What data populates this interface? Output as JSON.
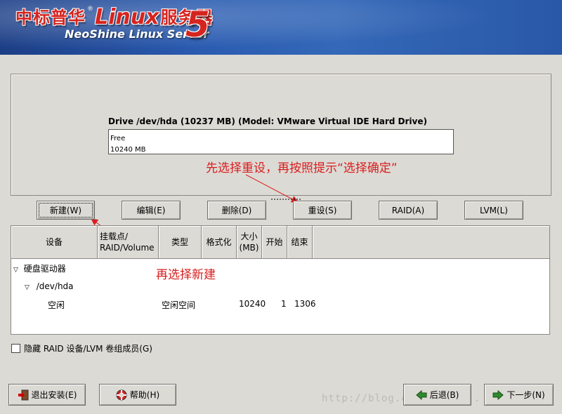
{
  "banner": {
    "logo_cn": "中标普华",
    "logo_reg": "®",
    "logo_linux": "Linux",
    "logo_cn2": "服务器",
    "logo_sub": "NeoShine Linux Server",
    "logo_version": "5"
  },
  "drive": {
    "title": "Drive /dev/hda (10237 MB) (Model: VMware Virtual IDE Hard Drive)",
    "seg_label": "Free",
    "seg_size": "10240 MB"
  },
  "annotations": {
    "a1": "先选择重设，再按照提示“选择确定”",
    "a2": "再选择新建"
  },
  "buttons": {
    "new": "新建(W)",
    "edit": "编辑(E)",
    "delete": "删除(D)",
    "reset": "重设(S)",
    "raid": "RAID(A)",
    "lvm": "LVM(L)"
  },
  "table": {
    "headers": {
      "device": "设备",
      "mount_l1": "挂载点/",
      "mount_l2": "RAID/Volume",
      "type": "类型",
      "format": "格式化",
      "size_l1": "大小",
      "size_l2": "(MB)",
      "start": "开始",
      "end": "结束"
    },
    "rows": {
      "disk_group": "硬盘驱动器",
      "disk": "/dev/hda",
      "free_device": "空闲",
      "free_type": "空闲空间",
      "free_size": "10240",
      "free_start": "1",
      "free_end": "1306"
    }
  },
  "options": {
    "hide_raid_lvm": "隐藏 RAID 设备/LVM 卷组成员(G)"
  },
  "footer": {
    "exit": "退出安装(E)",
    "help": "帮助(H)",
    "back": "后退(B)",
    "next": "下一步(N)"
  },
  "watermark": "http://blog.csdn.net/...",
  "colors": {
    "annotation": "#d81e1e",
    "banner_blue": "#2a5bb0",
    "logo_red": "#d6241f"
  }
}
